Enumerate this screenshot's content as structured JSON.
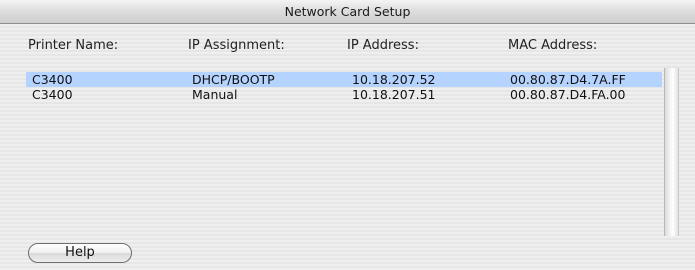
{
  "window": {
    "title": "Network Card Setup"
  },
  "columns": {
    "printer_name": "Printer Name:",
    "ip_assignment": "IP Assignment:",
    "ip_address": "IP Address:",
    "mac_address": "MAC Address:"
  },
  "rows": [
    {
      "printer_name": "C3400",
      "ip_assignment": "DHCP/BOOTP",
      "ip_address": "10.18.207.52",
      "mac_address": "00.80.87.D4.7A.FF",
      "selected": true
    },
    {
      "printer_name": "C3400",
      "ip_assignment": "Manual",
      "ip_address": "10.18.207.51",
      "mac_address": "00.80.87.D4.FA.00",
      "selected": false
    }
  ],
  "buttons": {
    "help_label": "Help"
  },
  "colors": {
    "selection": "#b5d3ff"
  }
}
